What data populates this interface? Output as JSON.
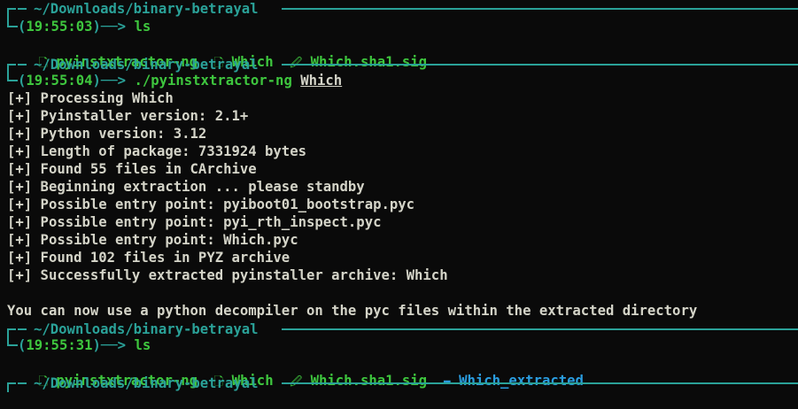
{
  "colors": {
    "background": "#0a0a0a",
    "prompt": "#2aa198",
    "file": "#3ec63e",
    "directory": "#2a9de0",
    "text": "#d4d4c8"
  },
  "prompts": [
    {
      "path": "~/Downloads/binary-betrayal",
      "time": "19:55:03",
      "command": "ls",
      "arg": ""
    },
    {
      "path": "~/Downloads/binary-betrayal",
      "time": "19:55:04",
      "command": "./pyinstxtractor-ng",
      "arg": "Which"
    },
    {
      "path": "~/Downloads/binary-betrayal",
      "time": "19:55:31",
      "command": "ls",
      "arg": ""
    },
    {
      "path": "~/Downloads/binary-betrayal"
    }
  ],
  "ls1": [
    {
      "icon": "file-icon",
      "glyph": "🗋",
      "name": "pyinstxtractor-ng"
    },
    {
      "icon": "file-icon",
      "glyph": "🗋",
      "name": "Which"
    },
    {
      "icon": "signature-file-icon",
      "glyph": "🖉",
      "name": "Which.sha1.sig"
    }
  ],
  "ls2": [
    {
      "icon": "file-icon",
      "glyph": "🗋",
      "name": "pyinstxtractor-ng"
    },
    {
      "icon": "file-icon",
      "glyph": "🗋",
      "name": "Which"
    },
    {
      "icon": "signature-file-icon",
      "glyph": "🖉",
      "name": "Which.sha1.sig"
    },
    {
      "icon": "folder-icon",
      "glyph": "▬",
      "name": "Which_extracted"
    }
  ],
  "output": [
    "[+] Processing Which",
    "[+] Pyinstaller version: 2.1+",
    "[+] Python version: 3.12",
    "[+] Length of package: 7331924 bytes",
    "[+] Found 55 files in CArchive",
    "[+] Beginning extraction ... please standby",
    "[+] Possible entry point: pyiboot01_bootstrap.pyc",
    "[+] Possible entry point: pyi_rth_inspect.pyc",
    "[+] Possible entry point: Which.pyc",
    "[+] Found 102 files in PYZ archive",
    "[+] Successfully extracted pyinstaller archive: Which",
    "",
    "You can now use a python decompiler on the pyc files within the extracted directory"
  ]
}
